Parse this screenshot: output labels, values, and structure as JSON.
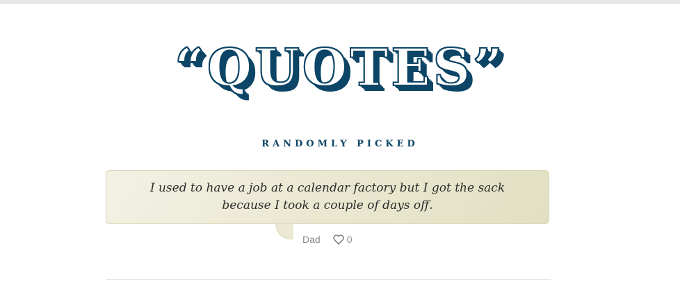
{
  "header": {
    "logo_text": "“QUOTES”",
    "subtitle": "RANDOMLY PICKED"
  },
  "quote": {
    "text": "I used to have a job at a calendar factory but I got the sack because I took a couple of days off.",
    "author": "Dad",
    "like_count": "0",
    "like_icon": "heart-icon"
  },
  "colors": {
    "brand": "#0d4566",
    "quote_bg_start": "#f3f1e4",
    "quote_bg_end": "#e2e0c2"
  }
}
